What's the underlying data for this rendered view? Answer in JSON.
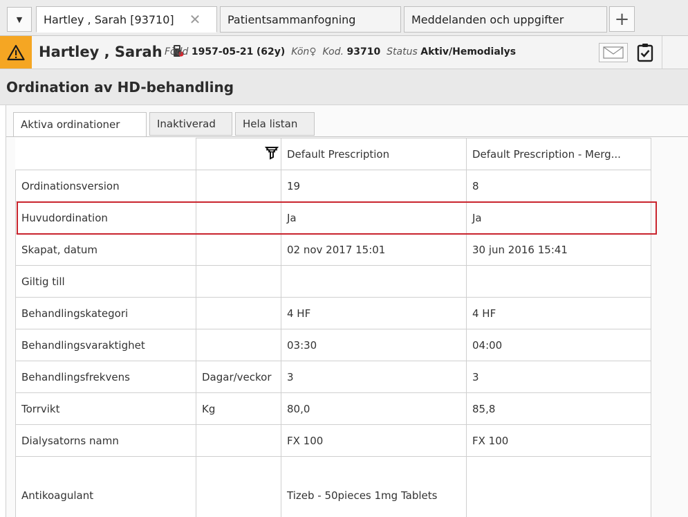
{
  "tabs": {
    "patient_tab": "Hartley , Sarah [93710]",
    "merge_tab": "Patientsammanfogning",
    "messages_tab": "Meddelanden och uppgifter",
    "close_glyph": "✕",
    "plus_glyph": "+",
    "dropdown_glyph": "▼"
  },
  "patient": {
    "name": "Hartley , Sarah",
    "born_label": "Född",
    "born_value": "1957-05-21",
    "age": "(62y)",
    "gender_label": "Kön",
    "gender_symbol": "♀",
    "code_label": "Kod.",
    "code_value": "93710",
    "status_label": "Status",
    "status_value": "Aktiv/Hemodialys"
  },
  "section": {
    "title": "Ordination av HD-behandling"
  },
  "subtabs": [
    "Aktiva ordinationer",
    "Inaktiverad",
    "Hela listan"
  ],
  "table": {
    "columns": [
      "Default Prescription",
      "Default Prescription - Merg..."
    ],
    "rows": [
      {
        "label": "Ordinationsversion",
        "unit": "",
        "v1": "19",
        "v2": "8"
      },
      {
        "label": "Huvudordination",
        "unit": "",
        "v1": "Ja",
        "v2": "Ja"
      },
      {
        "label": "Skapat, datum",
        "unit": "",
        "v1": "02 nov 2017 15:01",
        "v2": "30 jun 2016 15:41"
      },
      {
        "label": "Giltig till",
        "unit": "",
        "v1": "",
        "v2": ""
      },
      {
        "label": "Behandlingskategori",
        "unit": "",
        "v1": "4 HF",
        "v2": "4 HF"
      },
      {
        "label": "Behandlingsvaraktighet",
        "unit": "",
        "v1": "03:30",
        "v2": "04:00"
      },
      {
        "label": "Behandlingsfrekvens",
        "unit": "Dagar/veckor",
        "v1": "3",
        "v2": "3"
      },
      {
        "label": "Torrvikt",
        "unit": "Kg",
        "v1": "80,0",
        "v2": "85,8"
      },
      {
        "label": "Dialysatorns namn",
        "unit": "",
        "v1": "FX 100",
        "v2": "FX 100"
      },
      {
        "label": "Antikoagulant",
        "unit": "",
        "v1": "Tizeb - 50pieces 1mg Tablets",
        "v2": ""
      }
    ]
  },
  "highlighted_row": "Huvudordination",
  "colors": {
    "warning": "#f5a623",
    "highlight_border": "#c9242d"
  }
}
